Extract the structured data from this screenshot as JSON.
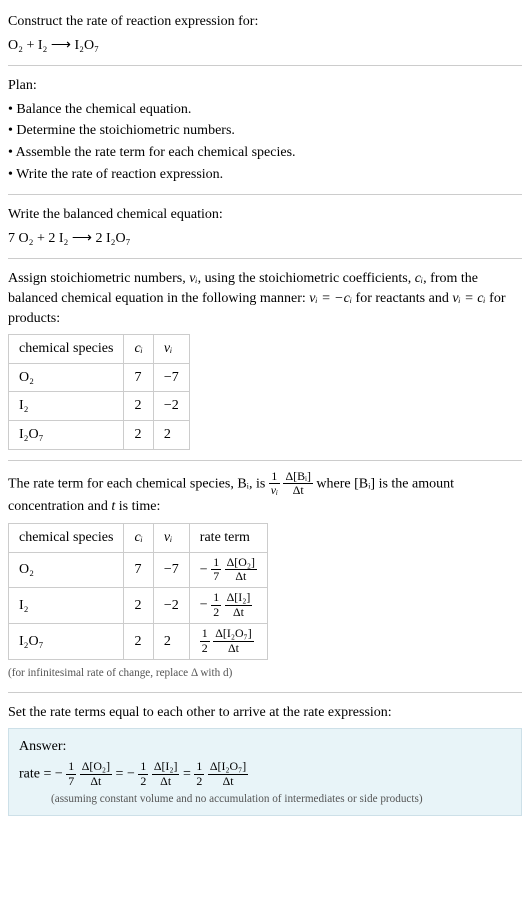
{
  "prompt": {
    "heading": "Construct the rate of reaction expression for:",
    "equation": "O₂ + I₂ ⟶ I₂O₇"
  },
  "plan": {
    "heading": "Plan:",
    "items": [
      "Balance the chemical equation.",
      "Determine the stoichiometric numbers.",
      "Assemble the rate term for each chemical species.",
      "Write the rate of reaction expression."
    ]
  },
  "balanced": {
    "heading": "Write the balanced chemical equation:",
    "equation": "7 O₂ + 2 I₂ ⟶ 2 I₂O₇"
  },
  "stoich": {
    "heading_pre": "Assign stoichiometric numbers, ",
    "nu_i": "νᵢ",
    "heading_mid1": ", using the stoichiometric coefficients, ",
    "c_i": "cᵢ",
    "heading_mid2": ", from the balanced chemical equation in the following manner: ",
    "rel_react": "νᵢ = −cᵢ",
    "heading_mid3": " for reactants and ",
    "rel_prod": "νᵢ = cᵢ",
    "heading_end": " for products:",
    "table": {
      "headers": [
        "chemical species",
        "cᵢ",
        "νᵢ"
      ],
      "rows": [
        {
          "species": "O₂",
          "c": "7",
          "nu": "−7"
        },
        {
          "species": "I₂",
          "c": "2",
          "nu": "−2"
        },
        {
          "species": "I₂O₇",
          "c": "2",
          "nu": "2"
        }
      ]
    }
  },
  "rateterm": {
    "heading_pre": "The rate term for each chemical species, Bᵢ, is ",
    "frac1_num": "1",
    "frac1_den": "νᵢ",
    "frac2_num": "Δ[Bᵢ]",
    "frac2_den": "Δt",
    "heading_mid": " where [Bᵢ] is the amount concentration and ",
    "t": "t",
    "heading_end": " is time:",
    "table": {
      "headers": [
        "chemical species",
        "cᵢ",
        "νᵢ",
        "rate term"
      ],
      "rows": [
        {
          "species": "O₂",
          "c": "7",
          "nu": "−7",
          "sign": "−",
          "a": "1",
          "b": "7",
          "dnum": "Δ[O₂]",
          "dden": "Δt"
        },
        {
          "species": "I₂",
          "c": "2",
          "nu": "−2",
          "sign": "−",
          "a": "1",
          "b": "2",
          "dnum": "Δ[I₂]",
          "dden": "Δt"
        },
        {
          "species": "I₂O₇",
          "c": "2",
          "nu": "2",
          "sign": "",
          "a": "1",
          "b": "2",
          "dnum": "Δ[I₂O₇]",
          "dden": "Δt"
        }
      ]
    },
    "note": "(for infinitesimal rate of change, replace Δ with d)"
  },
  "final": {
    "heading": "Set the rate terms equal to each other to arrive at the rate expression:",
    "answer_label": "Answer:",
    "rate_label": "rate = ",
    "terms": [
      {
        "sign": "−",
        "a": "1",
        "b": "7",
        "dnum": "Δ[O₂]",
        "dden": "Δt"
      },
      {
        "sign": "−",
        "a": "1",
        "b": "2",
        "dnum": "Δ[I₂]",
        "dden": "Δt"
      },
      {
        "sign": "",
        "a": "1",
        "b": "2",
        "dnum": "Δ[I₂O₇]",
        "dden": "Δt"
      }
    ],
    "eq": " = ",
    "assumption": "(assuming constant volume and no accumulation of intermediates or side products)"
  },
  "chart_data": {
    "type": "table",
    "title": "Stoichiometric numbers and rate terms",
    "tables": [
      {
        "name": "stoichiometric_numbers",
        "columns": [
          "chemical species",
          "c_i",
          "nu_i"
        ],
        "rows": [
          [
            "O2",
            7,
            -7
          ],
          [
            "I2",
            2,
            -2
          ],
          [
            "I2O7",
            2,
            2
          ]
        ]
      },
      {
        "name": "rate_terms",
        "columns": [
          "chemical species",
          "c_i",
          "nu_i",
          "rate term"
        ],
        "rows": [
          [
            "O2",
            7,
            -7,
            "-(1/7) Δ[O2]/Δt"
          ],
          [
            "I2",
            2,
            -2,
            "-(1/2) Δ[I2]/Δt"
          ],
          [
            "I2O7",
            2,
            2,
            "(1/2) Δ[I2O7]/Δt"
          ]
        ]
      }
    ]
  }
}
